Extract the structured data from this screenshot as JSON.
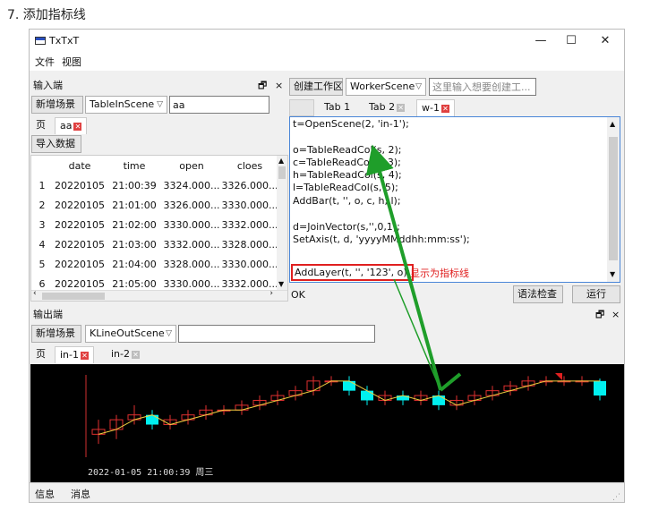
{
  "heading": "7. 添加指标线",
  "window": {
    "title": "TxTxT",
    "minimize": "—",
    "maximize": "☐",
    "close": "✕"
  },
  "menu": [
    "文件",
    "视图"
  ],
  "input_panel": {
    "title": "输入端",
    "float": "🗗",
    "close": "×",
    "add_scene": "新增场景",
    "scene_type": "TableInScene",
    "scene_name": "aa",
    "tabs": [
      "页",
      "aa"
    ],
    "import_button": "导入数据",
    "columns": [
      "",
      "date",
      "time",
      "open",
      "cloes"
    ],
    "rows": [
      [
        "1",
        "20220105",
        "21:00:39",
        "3324.000...",
        "3326.000..."
      ],
      [
        "2",
        "20220105",
        "21:01:00",
        "3326.000...",
        "3330.000..."
      ],
      [
        "3",
        "20220105",
        "21:02:00",
        "3330.000...",
        "3332.000..."
      ],
      [
        "4",
        "20220105",
        "21:03:00",
        "3332.000...",
        "3328.000..."
      ],
      [
        "5",
        "20220105",
        "21:04:00",
        "3328.000...",
        "3330.000..."
      ],
      [
        "6",
        "20220105",
        "21:05:00",
        "3330.000...",
        "3332.000..."
      ]
    ]
  },
  "worker": {
    "create_button": "创建工作区",
    "scene_type": "WorkerScene",
    "placeholder": "这里输入想要创建工...",
    "tabs": [
      "Tab 1",
      "Tab 2",
      "w-1"
    ],
    "code": [
      "t=OpenScene(2, 'in-1');",
      "",
      "o=TableReadCol(s, 2);",
      "c=TableReadCol(s, 3);",
      "h=TableReadCol(s, 4);",
      "l=TableReadCol(s, 5);",
      "AddBar(t, '', o, c, h, l);",
      "",
      "d=JoinVector(s,'',0,1);",
      "SetAxis(t, d, 'yyyyMMddhh:mm:ss');",
      "",
      "",
      "AddLayer(t, '', '123', o);"
    ],
    "annotation": "显示为指标线",
    "status": "OK",
    "check_button": "语法检查",
    "run_button": "运行"
  },
  "output_panel": {
    "title": "输出端",
    "float": "🗗",
    "close": "×",
    "add_scene": "新增场景",
    "scene_type": "KLineOutScene",
    "scene_name": "",
    "tabs": [
      "页",
      "in-1",
      "in-2"
    ],
    "timestamp": "2022-01-05 21:00:39 周三"
  },
  "statusbar": [
    "信息",
    "消息"
  ],
  "colors": {
    "red_frame": "#e02020",
    "annotation": "#e02020",
    "arrow": "#1f9e2a",
    "up_candle": "#e03030",
    "down_candle": "#00f0f0",
    "indicator": "#f0d040"
  },
  "chart_data": {
    "type": "candlestick",
    "candles": [
      {
        "o": 3324,
        "c": 3326,
        "h": 3330,
        "l": 3320
      },
      {
        "o": 3326,
        "c": 3330,
        "h": 3332,
        "l": 3322
      },
      {
        "o": 3330,
        "c": 3332,
        "h": 3336,
        "l": 3328
      },
      {
        "o": 3332,
        "c": 3328,
        "h": 3334,
        "l": 3326
      },
      {
        "o": 3328,
        "c": 3330,
        "h": 3332,
        "l": 3326
      },
      {
        "o": 3330,
        "c": 3332,
        "h": 3334,
        "l": 3328
      },
      {
        "o": 3332,
        "c": 3334,
        "h": 3336,
        "l": 3330
      },
      {
        "o": 3334,
        "c": 3334,
        "h": 3336,
        "l": 3332
      },
      {
        "o": 3334,
        "c": 3336,
        "h": 3338,
        "l": 3332
      },
      {
        "o": 3336,
        "c": 3338,
        "h": 3340,
        "l": 3334
      },
      {
        "o": 3338,
        "c": 3340,
        "h": 3342,
        "l": 3336
      },
      {
        "o": 3340,
        "c": 3342,
        "h": 3344,
        "l": 3338
      },
      {
        "o": 3342,
        "c": 3346,
        "h": 3348,
        "l": 3340
      },
      {
        "o": 3346,
        "c": 3346,
        "h": 3348,
        "l": 3344
      },
      {
        "o": 3346,
        "c": 3342,
        "h": 3348,
        "l": 3340
      },
      {
        "o": 3342,
        "c": 3338,
        "h": 3344,
        "l": 3336
      },
      {
        "o": 3338,
        "c": 3340,
        "h": 3342,
        "l": 3336
      },
      {
        "o": 3340,
        "c": 3338,
        "h": 3342,
        "l": 3336
      },
      {
        "o": 3338,
        "c": 3340,
        "h": 3342,
        "l": 3336
      },
      {
        "o": 3340,
        "c": 3336,
        "h": 3342,
        "l": 3334
      },
      {
        "o": 3336,
        "c": 3338,
        "h": 3340,
        "l": 3334
      },
      {
        "o": 3338,
        "c": 3340,
        "h": 3342,
        "l": 3336
      },
      {
        "o": 3340,
        "c": 3342,
        "h": 3344,
        "l": 3338
      },
      {
        "o": 3342,
        "c": 3344,
        "h": 3346,
        "l": 3340
      },
      {
        "o": 3344,
        "c": 3346,
        "h": 3348,
        "l": 3342
      },
      {
        "o": 3346,
        "c": 3346,
        "h": 3348,
        "l": 3344
      },
      {
        "o": 3346,
        "c": 3346,
        "h": 3348,
        "l": 3344
      },
      {
        "o": 3346,
        "c": 3346,
        "h": 3348,
        "l": 3344
      },
      {
        "o": 3346,
        "c": 3340,
        "h": 3347,
        "l": 3338
      }
    ],
    "indicator": [
      3324,
      3326,
      3330,
      3332,
      3328,
      3330,
      3332,
      3334,
      3334,
      3336,
      3338,
      3340,
      3342,
      3346,
      3346,
      3342,
      3338,
      3340,
      3338,
      3340,
      3336,
      3338,
      3340,
      3342,
      3344,
      3346,
      3346,
      3346,
      3346
    ],
    "ylim": [
      3316,
      3350
    ]
  }
}
